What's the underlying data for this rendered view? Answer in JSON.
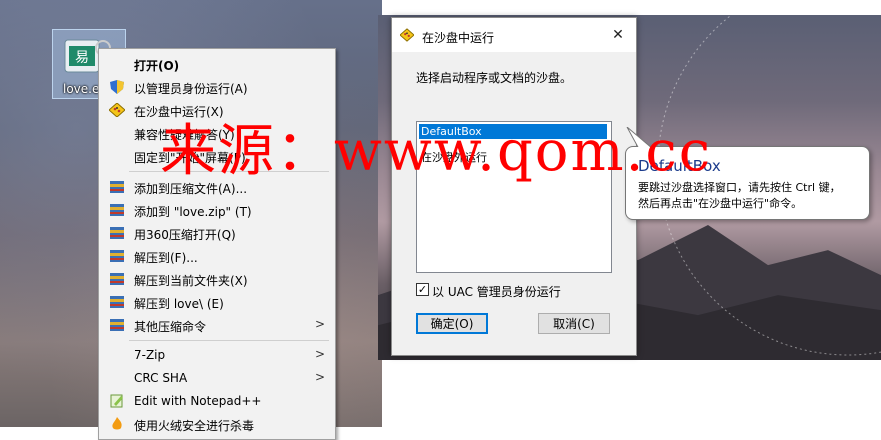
{
  "desktop": {
    "icon_label": "love.e"
  },
  "context_menu": {
    "items": [
      {
        "label": "打开(O)",
        "icon": "none",
        "bold": true
      },
      {
        "label": "以管理员身份运行(A)",
        "icon": "uac-shield-icon"
      },
      {
        "label": "在沙盘中运行(X)",
        "icon": "sandbox-icon"
      },
      {
        "label": "兼容性疑难解答(Y)",
        "icon": "none"
      },
      {
        "label": "固定到\"开始\"屏幕(P)",
        "icon": "none"
      },
      {
        "label": "添加到压缩文件(A)...",
        "icon": "archive-icon"
      },
      {
        "label": "添加到 \"love.zip\" (T)",
        "icon": "archive-icon"
      },
      {
        "label": "用360压缩打开(Q)",
        "icon": "archive-icon"
      },
      {
        "label": "解压到(F)...",
        "icon": "archive-icon"
      },
      {
        "label": "解压到当前文件夹(X)",
        "icon": "archive-icon"
      },
      {
        "label": "解压到 love\\ (E)",
        "icon": "archive-icon"
      },
      {
        "label": "其他压缩命令",
        "icon": "archive-icon",
        "submenu": true
      },
      {
        "label": "7-Zip",
        "icon": "none",
        "submenu": true
      },
      {
        "label": "CRC SHA",
        "icon": "none",
        "submenu": true
      },
      {
        "label": "Edit with Notepad++",
        "icon": "notepad-icon"
      },
      {
        "label": "使用火绒安全进行杀毒",
        "icon": "huorong-icon"
      }
    ],
    "submenu_arrow": ">"
  },
  "dialog": {
    "title": "在沙盘中运行",
    "close_glyph": "✕",
    "description": "选择启动程序或文档的沙盘。",
    "list_items": [
      "DefaultBox",
      "在沙盘外运行"
    ],
    "selected_index": 0,
    "uac_checkbox_label": "以 UAC 管理员身份运行",
    "uac_checked": true,
    "ok_label": "确定(O)",
    "cancel_label": "取消(C)"
  },
  "tooltip": {
    "title": "DefaultBox",
    "line1": "要跳过沙盘选择窗口，请先按住 Ctrl 键，",
    "line2": "然后再点击\"在沙盘中运行\"命令。"
  },
  "watermark": {
    "text": "来源：www.qom.cc",
    "color": "#ff0000"
  },
  "colors": {
    "selection": "#0078d7",
    "menu_bg": "#f2f2f2",
    "dialog_bg": "#f0f0f0"
  }
}
